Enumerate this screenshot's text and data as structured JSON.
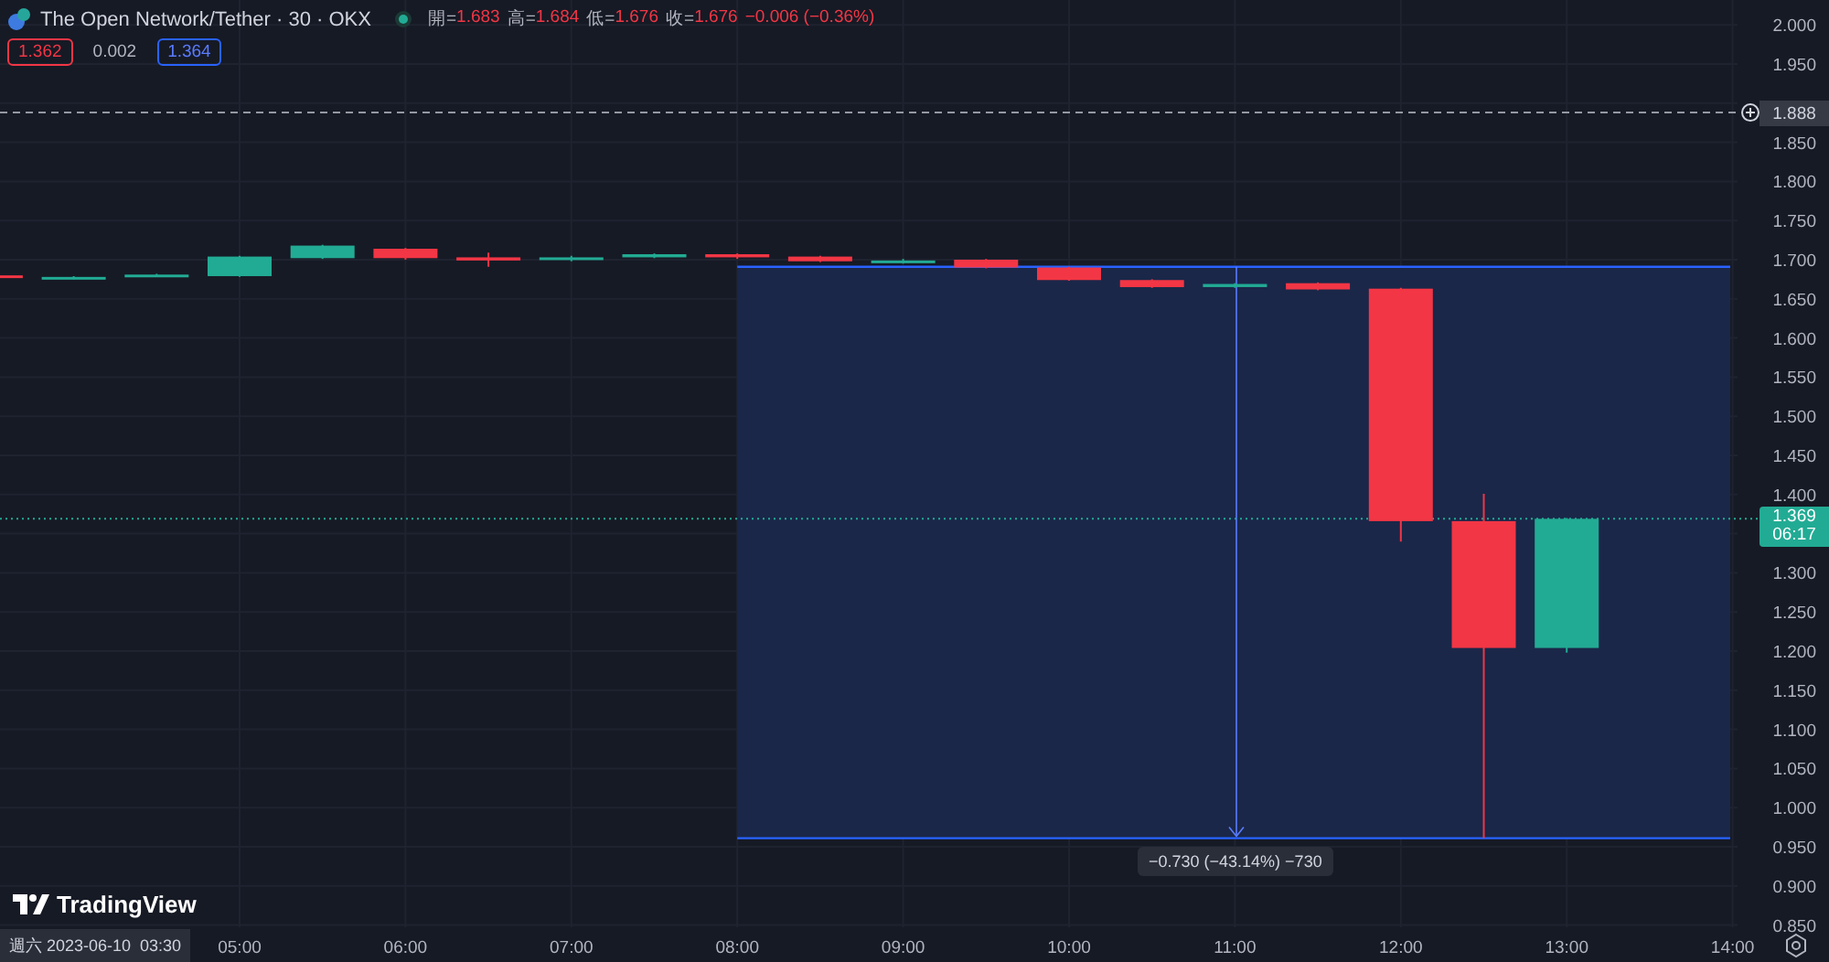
{
  "header": {
    "title": "The Open Network/Tether · 30 · OKX",
    "ohlc": [
      {
        "label": "開=",
        "value": "1.683"
      },
      {
        "label": "高=",
        "value": "1.684"
      },
      {
        "label": "低=",
        "value": "1.676"
      },
      {
        "label": "收=",
        "value": "1.676"
      }
    ],
    "change": "−0.006 (−0.36%)",
    "quotes": [
      {
        "kind": "bid",
        "value": "1.362"
      },
      {
        "kind": "spread",
        "value": "0.002"
      },
      {
        "kind": "ask",
        "value": "1.364"
      }
    ]
  },
  "chart": {
    "price_axis": [
      "2.000",
      "1.950",
      "1.850",
      "1.800",
      "1.750",
      "1.700",
      "1.650",
      "1.600",
      "1.550",
      "1.500",
      "1.450",
      "1.400",
      "1.300",
      "1.250",
      "1.200",
      "1.150",
      "1.100",
      "1.050",
      "1.000",
      "0.950",
      "0.900",
      "0.850"
    ],
    "time_axis": [
      "05:00",
      "06:00",
      "07:00",
      "08:00",
      "09:00",
      "10:00",
      "11:00",
      "12:00",
      "13:00",
      "14:00"
    ],
    "alert_price": "1.888",
    "measure_label": "−0.730 (−43.14%) −730",
    "last_price": {
      "price": "1.369",
      "countdown": "06:17"
    },
    "cursor_time": "週六 2023-06-10  03:30"
  },
  "logo": "TradingView"
}
